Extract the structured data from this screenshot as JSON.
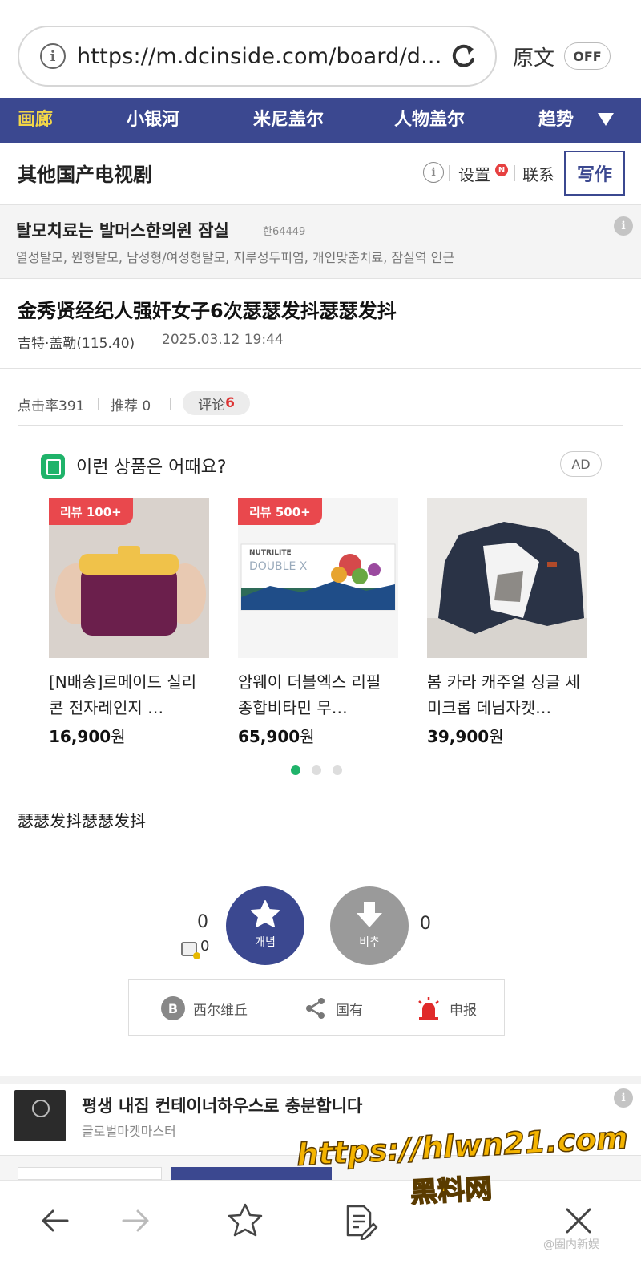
{
  "browser": {
    "url": "https://m.dcinside.com/board/d...",
    "translate_label": "原文",
    "translate_toggle": "OFF"
  },
  "nav": {
    "items": [
      {
        "label": "画廊",
        "active": true
      },
      {
        "label": "小银河",
        "active": false
      },
      {
        "label": "米尼盖尔",
        "active": false
      },
      {
        "label": "人物盖尔",
        "active": false
      },
      {
        "label": "趋势",
        "active": false
      }
    ]
  },
  "gallery": {
    "title": "其他国产电视剧",
    "info_glyph": "i",
    "settings": "设置",
    "new_badge": "N",
    "contact": "联系",
    "write": "写作"
  },
  "text_ad": {
    "title": "탈모치료는 발머스한의원 잠실",
    "phone": "한64449",
    "desc": "열성탈모, 원형탈모, 남성형/여성형탈모, 지루성두피염, 개인맞춤치료, 잠실역 인근"
  },
  "post": {
    "title": "金秀贤经纪人强奸女子6次瑟瑟发抖瑟瑟发抖",
    "author": "吉特·盖勒(115.40)",
    "date": "2025.03.12 19:44",
    "views_label": "点击率391",
    "recommend_label": "推荐 0",
    "comment_label": "评论",
    "comment_count": "6",
    "body": "瑟瑟发抖瑟瑟发抖"
  },
  "product_ad": {
    "title": "이런 상품은 어때요?",
    "ad_badge": "AD",
    "products": [
      {
        "badge": "리뷰 100+",
        "name": "[N배송]르메이드 실리콘 전자레인지 …",
        "price": "16,900",
        "currency": "원"
      },
      {
        "badge": "리뷰 500+",
        "name": "암웨이 더블엑스 리필 종합비타민 무…",
        "price": "65,900",
        "currency": "원"
      },
      {
        "badge": "",
        "name": "봄 카라 캐주얼 싱글 세미크롭 데님자켓…",
        "price": "39,900",
        "currency": "원"
      }
    ],
    "package_brand": "NUTRILITE",
    "package_name": "DOUBLE X",
    "page_count": 3,
    "active_page": 1
  },
  "votes": {
    "up_count": "0",
    "fix_count": "0",
    "up_label": "개념",
    "down_label": "비추",
    "down_count": "0"
  },
  "actions": {
    "b_glyph": "B",
    "bookmark": "西尔维丘",
    "share": "国有",
    "report": "申报"
  },
  "bottom_ad": {
    "title": "평생 내집 컨테이너하우스로 충분합니다",
    "sub": "글로벌마켓마스터"
  },
  "watermark": {
    "url": "https://hlwn21.com",
    "name": "黑料网",
    "credit": "@圈内新娱"
  },
  "colors": {
    "nav_bg": "#3b4890",
    "nav_active": "#f2d648",
    "accent_green": "#1fb36a",
    "badge_red": "#e9484d"
  }
}
